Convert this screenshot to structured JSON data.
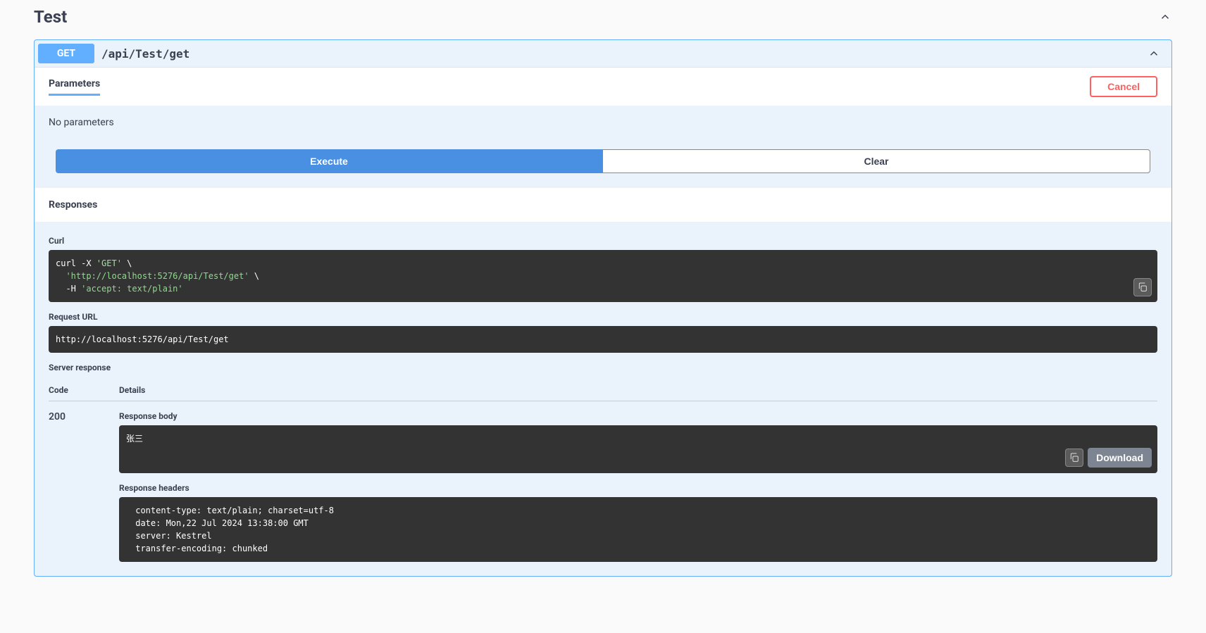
{
  "section": {
    "title": "Test"
  },
  "operation": {
    "method": "GET",
    "path": "/api/Test/get"
  },
  "parameters": {
    "tab_label": "Parameters",
    "cancel_label": "Cancel",
    "empty_text": "No parameters",
    "execute_label": "Execute",
    "clear_label": "Clear"
  },
  "responses": {
    "title": "Responses",
    "curl_label": "Curl",
    "curl_prefix": "curl -X ",
    "curl_method": "'GET'",
    "curl_url": "'http://localhost:5276/api/Test/get'",
    "curl_header": "'accept: text/plain'",
    "request_url_label": "Request URL",
    "request_url": "http://localhost:5276/api/Test/get",
    "server_response_label": "Server response",
    "code_header": "Code",
    "details_header": "Details",
    "status_code": "200",
    "body_label": "Response body",
    "body_text": "张三",
    "download_label": "Download",
    "headers_label": "Response headers",
    "headers_text": " content-type: text/plain; charset=utf-8 \n date: Mon,22 Jul 2024 13:38:00 GMT \n server: Kestrel \n transfer-encoding: chunked "
  }
}
